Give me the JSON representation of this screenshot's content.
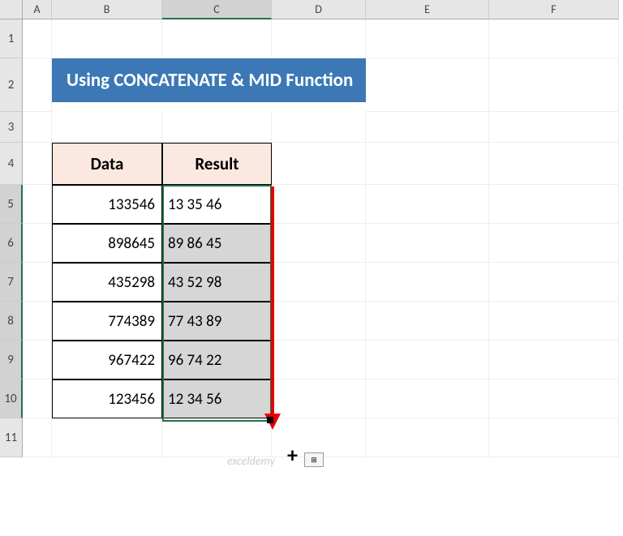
{
  "columns": [
    "A",
    "B",
    "C",
    "D",
    "E",
    "F"
  ],
  "rows": [
    "1",
    "2",
    "3",
    "4",
    "5",
    "6",
    "7",
    "8",
    "9",
    "10",
    "11"
  ],
  "selectedColumn": "C",
  "selectedRows": [
    "5",
    "6",
    "7",
    "8",
    "9",
    "10"
  ],
  "title": "Using CONCATENATE & MID Function",
  "headers": {
    "data": "Data",
    "result": "Result"
  },
  "table": [
    {
      "data": "133546",
      "result": "13 35 46"
    },
    {
      "data": "898645",
      "result": "89 86 45"
    },
    {
      "data": "435298",
      "result": "43 52 98"
    },
    {
      "data": "774389",
      "result": "77 43 89"
    },
    {
      "data": "967422",
      "result": "96 74 22"
    },
    {
      "data": "123456",
      "result": "12 34 56"
    }
  ],
  "watermark": "exceldemy",
  "autofill_glyph": "⊞"
}
